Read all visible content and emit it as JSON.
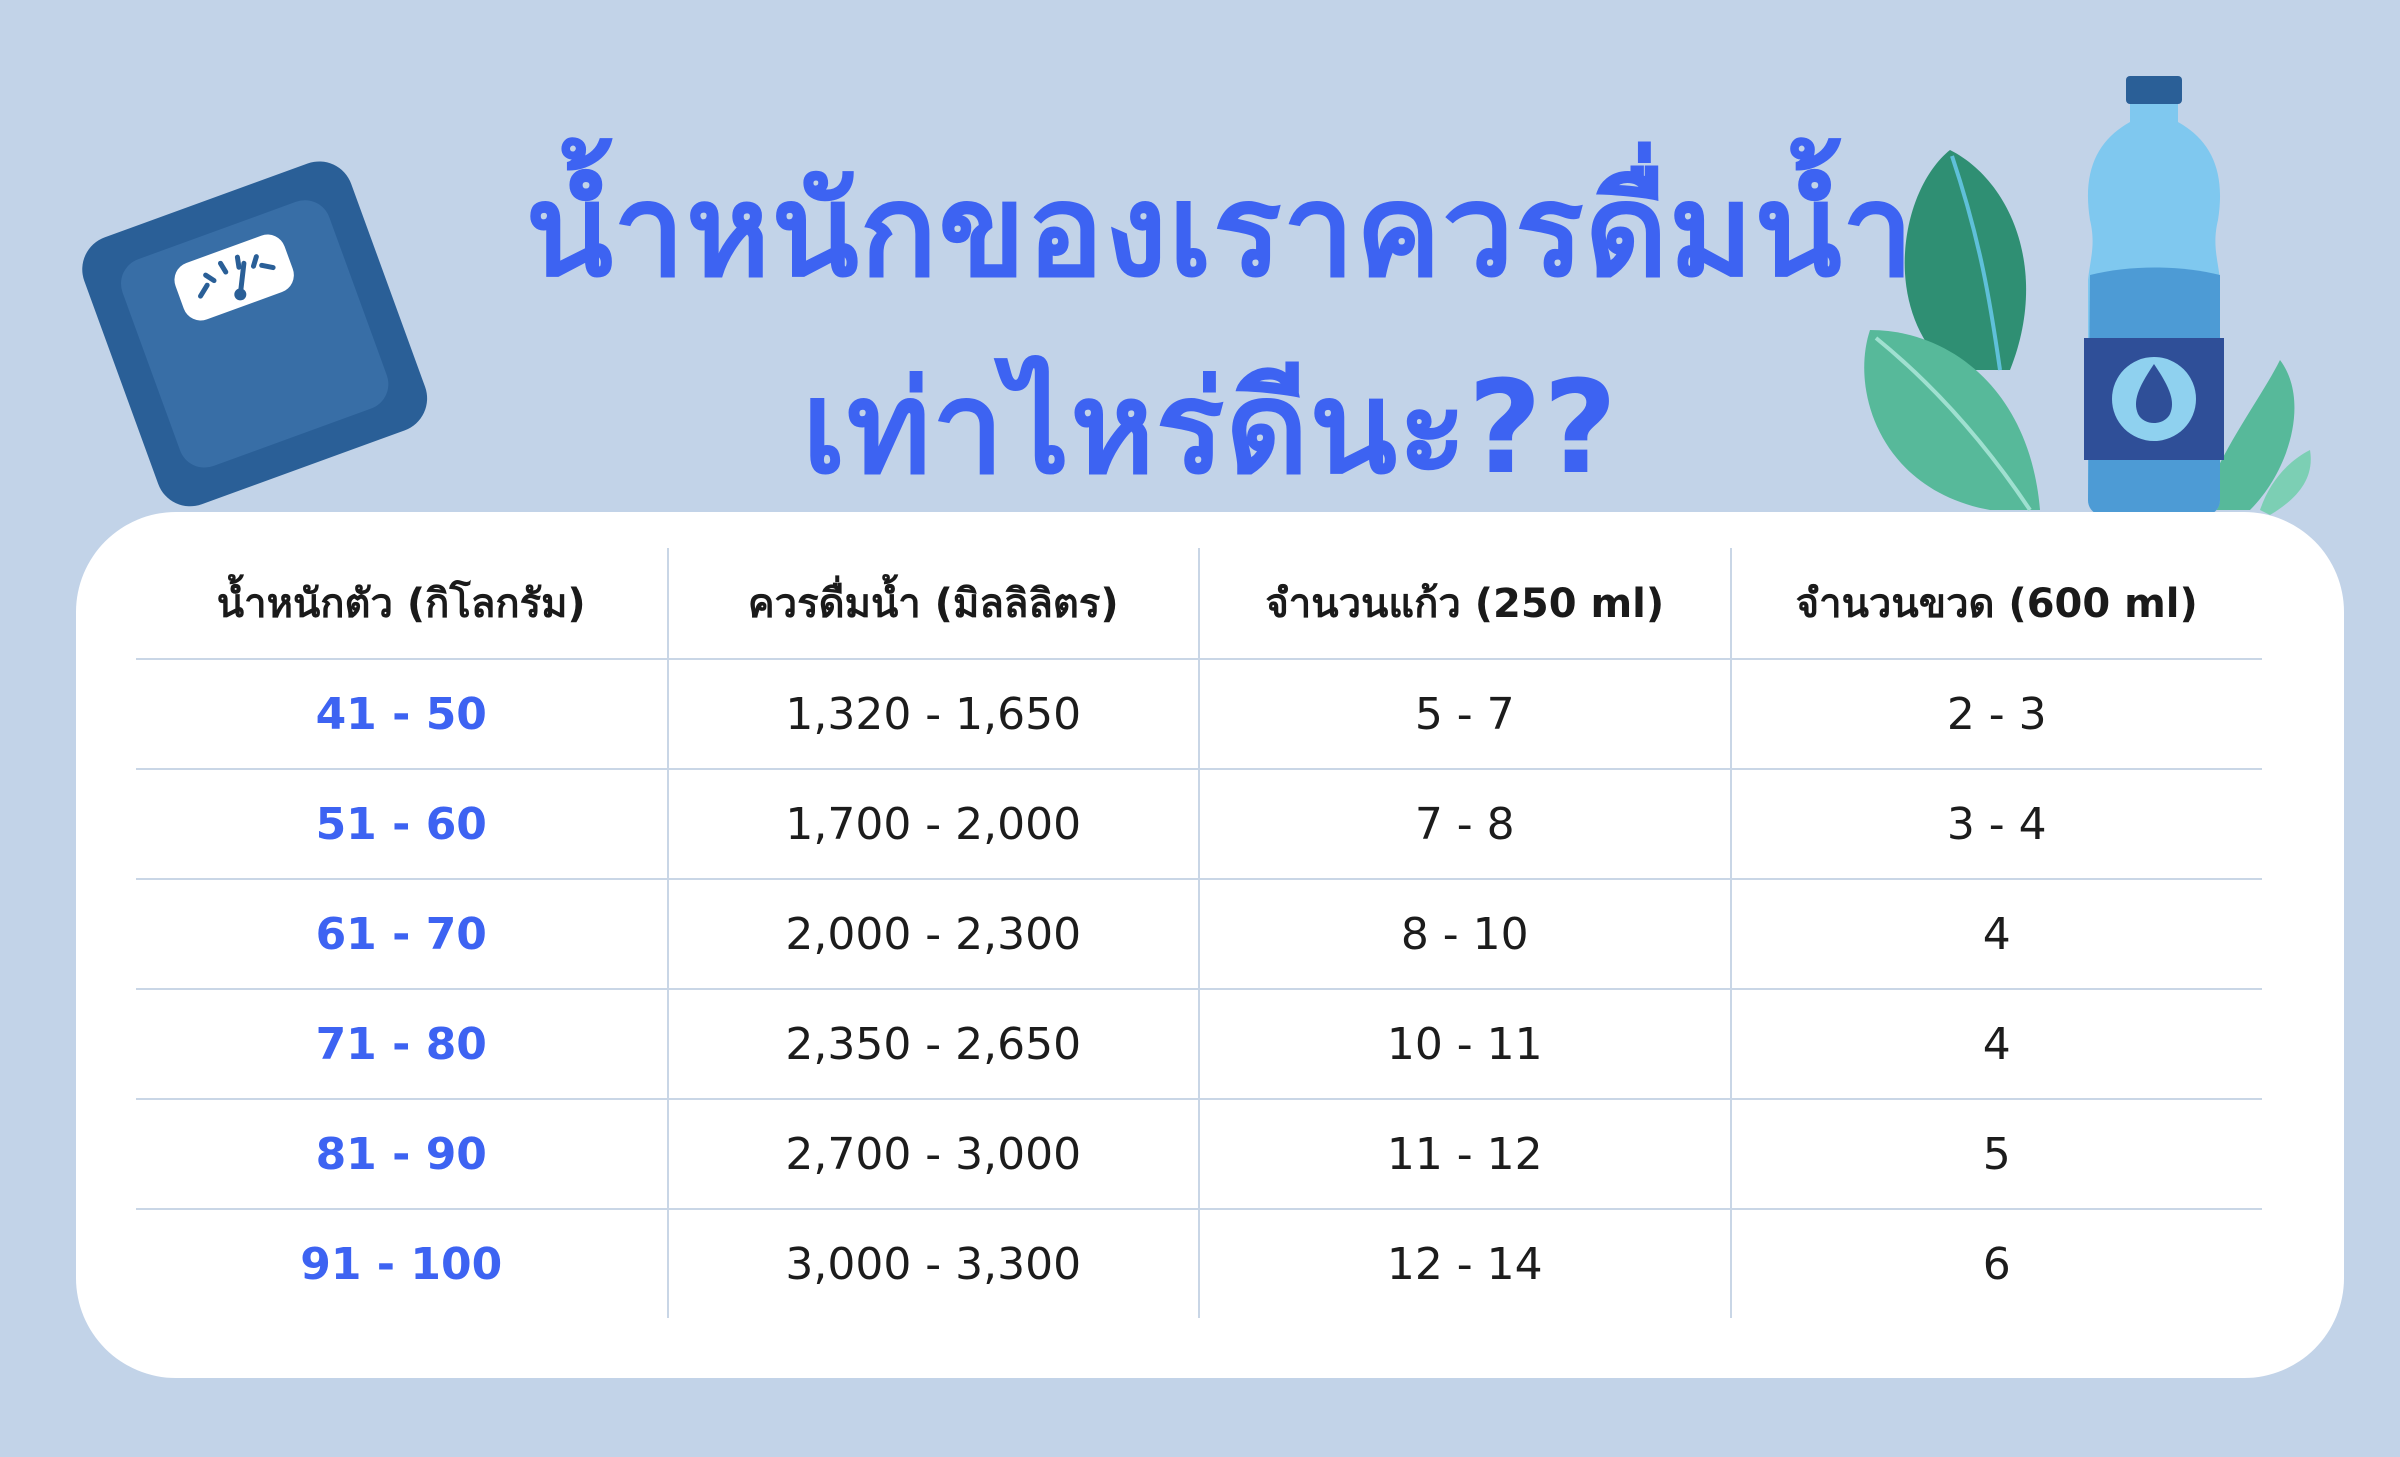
{
  "title": {
    "line1": "น้ำหนักของเราควรดื่มน้ำ",
    "line2": "เท่าไหร่ดีนะ??"
  },
  "colors": {
    "background": "#c2d3e8",
    "title": "#3d63f2",
    "weight_text": "#3d63f2",
    "card": "#ffffff"
  },
  "icons": [
    "bathroom-scale-icon",
    "leaves-icon",
    "water-bottle-icon"
  ],
  "table": {
    "headers": [
      "น้ำหนักตัว (กิโลกรัม)",
      "ควรดื่มน้ำ (มิลลิลิตร)",
      "จำนวนแก้ว (250 ml)",
      "จำนวนขวด (600 ml)"
    ],
    "rows": [
      [
        "41 - 50",
        "1,320 - 1,650",
        "5 - 7",
        "2 - 3"
      ],
      [
        "51 - 60",
        "1,700 - 2,000",
        "7 - 8",
        "3 - 4"
      ],
      [
        "61 - 70",
        "2,000 - 2,300",
        "8 - 10",
        "4"
      ],
      [
        "71 - 80",
        "2,350 - 2,650",
        "10 - 11",
        "4"
      ],
      [
        "81 - 90",
        "2,700 - 3,000",
        "11 - 12",
        "5"
      ],
      [
        "91 - 100",
        "3,000 - 3,300",
        "12 - 14",
        "6"
      ]
    ]
  }
}
